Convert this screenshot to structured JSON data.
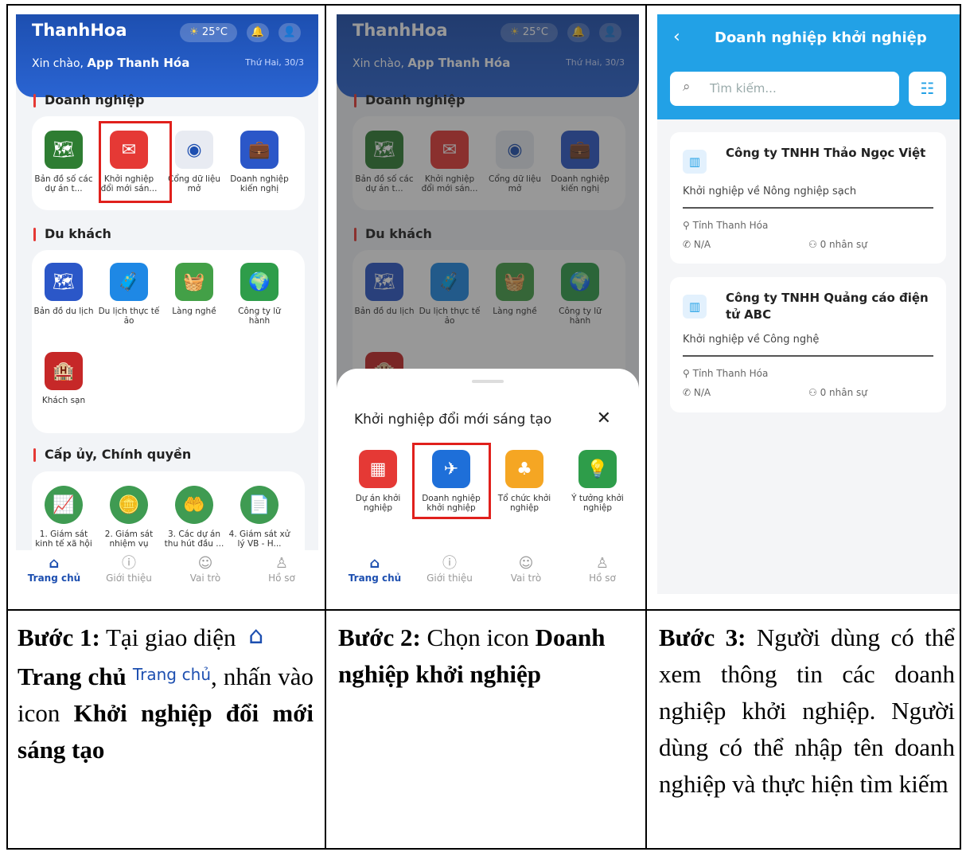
{
  "app": {
    "title": "ThanhHoa",
    "weather": "25°C",
    "greeting_prefix": "Xin chào,",
    "greeting_name": "App Thanh Hóa",
    "date": "Thứ Hai, 30/3"
  },
  "sections": {
    "business": {
      "title": "Doanh nghiệp",
      "items": [
        {
          "label": "Bản đồ số các dự án t...",
          "color": "#2e7d32",
          "icon": "map-icon"
        },
        {
          "label": "Khởi nghiệp đổi mới sán...",
          "color": "#e53935",
          "icon": "startup-icon"
        },
        {
          "label": "Cổng dữ liệu mở",
          "color": "#9aa3b5",
          "icon": "data-portal-icon"
        },
        {
          "label": "Doanh nghiệp kiến nghị",
          "color": "#2b57c8",
          "icon": "briefcase-icon"
        }
      ]
    },
    "tourist": {
      "title": "Du khách",
      "items": [
        {
          "label": "Bản đồ du lịch",
          "color": "#2b57c8",
          "icon": "map-icon"
        },
        {
          "label": "Du lịch thực tế ảo",
          "color": "#1e88e5",
          "icon": "luggage-icon"
        },
        {
          "label": "Làng nghề",
          "color": "#43a047",
          "icon": "craft-village-icon"
        },
        {
          "label": "Công ty lữ hành",
          "color": "#2e9d4a",
          "icon": "travel-company-icon"
        },
        {
          "label": "Khách sạn",
          "color": "#c62828",
          "icon": "hotel-icon"
        }
      ]
    },
    "government": {
      "title": "Cấp ủy, Chính quyền",
      "items": [
        {
          "label": "1. Giám sát kinh tế xã hội",
          "color": "#3f9b52",
          "icon": "chart-icon"
        },
        {
          "label": "2. Giám sát nhiệm vụ",
          "color": "#3f9b52",
          "icon": "coin-icon"
        },
        {
          "label": "3. Các dự án thu hút đầu ...",
          "color": "#3f9b52",
          "icon": "hand-coin-icon"
        },
        {
          "label": "4. Giám sát xử lý VB - H...",
          "color": "#3f9b52",
          "icon": "document-icon"
        }
      ]
    }
  },
  "bottom_nav": [
    {
      "label": "Trang chủ",
      "icon": "home-icon"
    },
    {
      "label": "Giới thiệu",
      "icon": "info-icon"
    },
    {
      "label": "Vai trò",
      "icon": "role-icon"
    },
    {
      "label": "Hồ sơ",
      "icon": "profile-icon"
    }
  ],
  "sheet": {
    "title": "Khởi nghiệp đổi mới sáng tạo",
    "close": "✕",
    "items": [
      {
        "label": "Dự án khởi nghiệp",
        "color": "#e53935",
        "icon": "project-icon"
      },
      {
        "label": "Doanh nghiệp khởi nghiệp",
        "color": "#1e6fd9",
        "icon": "startup-business-icon"
      },
      {
        "label": "Tổ chức khởi nghiệp",
        "color": "#f5a623",
        "icon": "organization-icon"
      },
      {
        "label": "Ý tưởng khởi nghiệp",
        "color": "#2e9d4a",
        "icon": "idea-icon"
      }
    ]
  },
  "list_screen": {
    "title": "Doanh nghiệp khởi nghiệp",
    "search_placeholder": "Tìm kiếm...",
    "enterprises": [
      {
        "name": "Công ty TNHH Thảo Ngọc Việt",
        "desc": "Khởi nghiệp về Nông nghiệp sạch",
        "location": "Tỉnh Thanh Hóa",
        "phone": "N/A",
        "staff": "0 nhân sự"
      },
      {
        "name": "Công ty TNHH Quảng cáo điện tử ABC",
        "desc": "Khởi nghiệp về Công nghệ",
        "location": "Tỉnh Thanh Hóa",
        "phone": "N/A",
        "staff": "0 nhân sự"
      }
    ]
  },
  "steps": {
    "s1_bold1": "Bước 1:",
    "s1_t1": "Tại giao diện",
    "s1_bold2": "Trang chủ",
    "s1_inline": "Trang chủ",
    "s1_t2": ", nhấn vào icon",
    "s1_bold3": "Khởi nghiệp đổi mới sáng tạo",
    "s2_bold1": "Bước 2:",
    "s2_t1": "Chọn icon",
    "s2_bold2": "Doanh nghiệp khởi nghiệp",
    "s3_bold1": "Bước 3:",
    "s3_t1": "Người dùng có thể xem thông tin các doanh nghiệp khởi nghiệp. Người dùng có thể nhập tên doanh nghiệp và thực hiện tìm kiếm"
  },
  "colors": {
    "primary": "#1d4fb0",
    "header_blue": "#22a1e6",
    "highlight": "#e0201c"
  }
}
